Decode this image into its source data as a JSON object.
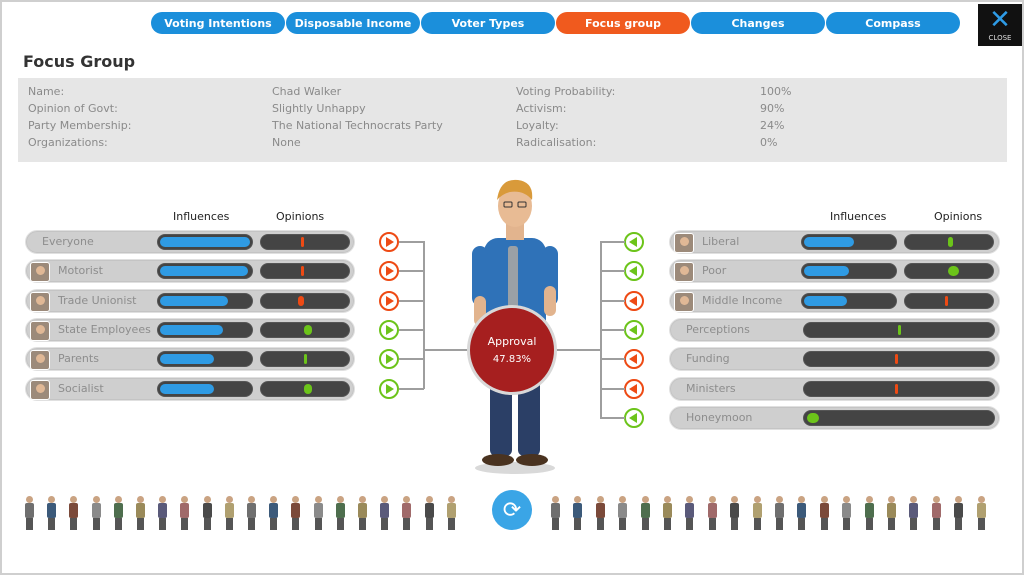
{
  "tabs": [
    {
      "label": "Voting Intentions",
      "active": false
    },
    {
      "label": "Disposable Income",
      "active": false
    },
    {
      "label": "Voter Types",
      "active": false
    },
    {
      "label": "Focus group",
      "active": true
    },
    {
      "label": "Changes",
      "active": false
    },
    {
      "label": "Compass",
      "active": false
    }
  ],
  "close_label": "CLOSE",
  "title": "Focus Group",
  "info": {
    "name_label": "Name:",
    "name_value": "Chad Walker",
    "opinion_label": "Opinion of Govt:",
    "opinion_value": "Slightly Unhappy",
    "party_label": "Party Membership:",
    "party_value": "The National Technocrats Party",
    "org_label": "Organizations:",
    "org_value": "None",
    "prob_label": "Voting Probability:",
    "prob_value": "100%",
    "activism_label": "Activism:",
    "activism_value": "90%",
    "loyalty_label": "Loyalty:",
    "loyalty_value": "24%",
    "radical_label": "Radicalisation:",
    "radical_value": "0%"
  },
  "columns": {
    "influences": "Influences",
    "opinions": "Opinions"
  },
  "left_groups": [
    {
      "label": "Everyone",
      "avatar": false,
      "influence": 1.0,
      "opinion": -0.05,
      "direction": "red"
    },
    {
      "label": "Motorist",
      "avatar": true,
      "influence": 0.98,
      "opinion": -0.08,
      "direction": "red"
    },
    {
      "label": "Trade Unionist",
      "avatar": true,
      "influence": 0.75,
      "opinion": -0.14,
      "direction": "red"
    },
    {
      "label": "State Employees",
      "avatar": true,
      "influence": 0.7,
      "opinion": 0.18,
      "direction": "green"
    },
    {
      "label": "Parents",
      "avatar": true,
      "influence": 0.6,
      "opinion": 0.02,
      "direction": "green"
    },
    {
      "label": "Socialist",
      "avatar": true,
      "influence": 0.6,
      "opinion": 0.18,
      "direction": "green"
    }
  ],
  "right_groups": [
    {
      "label": "Liberal",
      "avatar": true,
      "influence": 0.55,
      "opinion": 0.12,
      "direction": "green",
      "bars": 2
    },
    {
      "label": "Poor",
      "avatar": true,
      "influence": 0.5,
      "opinion": 0.25,
      "direction": "green",
      "bars": 2
    },
    {
      "label": "Middle Income",
      "avatar": true,
      "influence": 0.48,
      "opinion": -0.05,
      "direction": "red",
      "bars": 2
    },
    {
      "label": "Perceptions",
      "avatar": false,
      "opinion": 0.01,
      "direction": "green",
      "bars": 1
    },
    {
      "label": "Funding",
      "avatar": false,
      "opinion": -0.03,
      "direction": "red",
      "bars": 1
    },
    {
      "label": "Ministers",
      "avatar": false,
      "opinion": -0.03,
      "direction": "red",
      "bars": 1
    },
    {
      "label": "Honeymoon",
      "avatar": false,
      "opinion": 0.06,
      "direction": "green",
      "bars": 1,
      "from_left": true
    }
  ],
  "approval": {
    "label": "Approval",
    "value": "47.83%"
  },
  "colors": {
    "tab": "#1b8fdb",
    "tab_active": "#f05a1e",
    "influence": "#2f9be4",
    "negative": "#ee4a14",
    "positive": "#6cc41a",
    "approval": "#a61f1f"
  },
  "icons": {
    "refresh": "refresh-icon",
    "close": "close-icon"
  }
}
